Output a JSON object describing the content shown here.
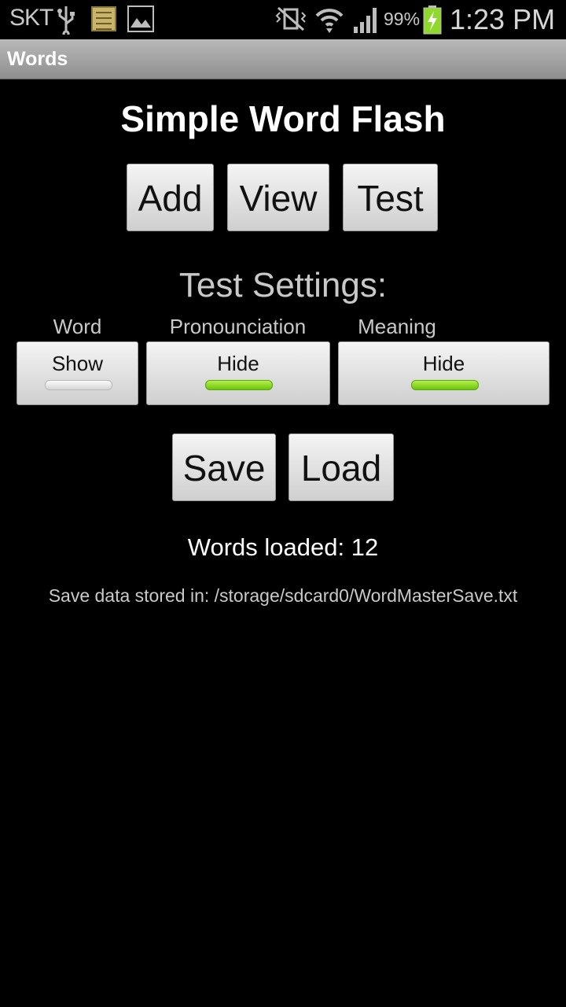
{
  "status_bar": {
    "carrier": "SKT",
    "battery_percent": "99%",
    "time": "1:23 PM",
    "icons": [
      "usb-icon",
      "notes-icon",
      "image-icon",
      "vibrate-icon",
      "wifi-icon",
      "signal-icon",
      "battery-charging-icon"
    ]
  },
  "titlebar": {
    "title": "Words"
  },
  "main": {
    "title": "Simple Word Flash",
    "buttons": {
      "add": "Add",
      "view": "View",
      "test": "Test"
    },
    "settings_title": "Test Settings:",
    "settings": [
      {
        "label": "Word",
        "state": "Show",
        "on": false
      },
      {
        "label": "Pronounciation",
        "state": "Hide",
        "on": true
      },
      {
        "label": "Meaning",
        "state": "Hide",
        "on": true
      }
    ],
    "save_label": "Save",
    "load_label": "Load",
    "words_loaded": "Words loaded: 12",
    "save_path": "Save data stored in: /storage/sdcard0/WordMasterSave.txt"
  },
  "colors": {
    "indicator_on": "#8fd82c",
    "indicator_off": "#e6e6e6"
  }
}
